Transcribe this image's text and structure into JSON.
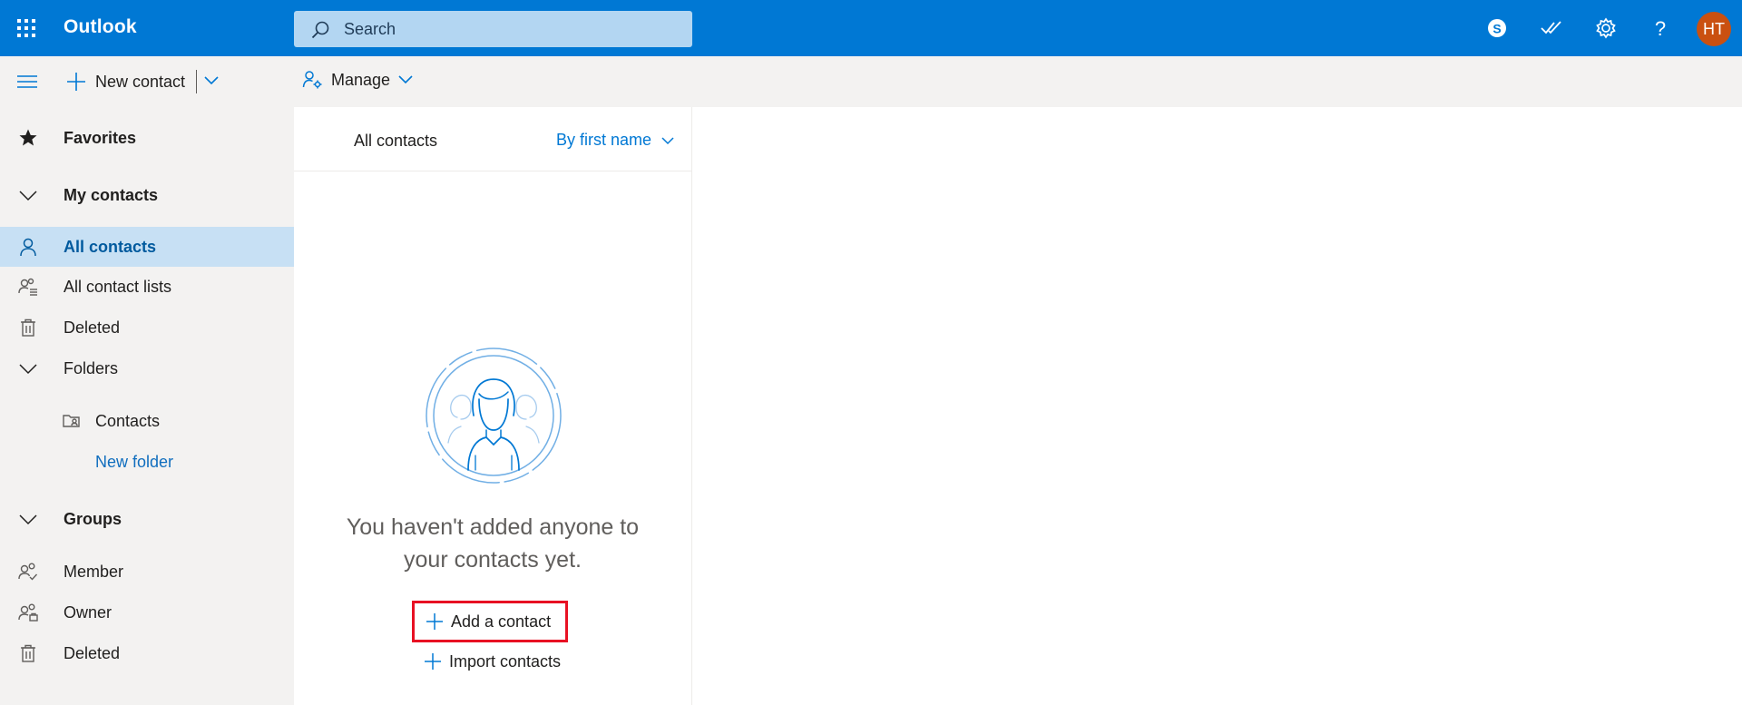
{
  "app": {
    "brand": "Outlook"
  },
  "search": {
    "placeholder": "Search"
  },
  "header": {
    "avatar_initials": "HT"
  },
  "toolbar": {
    "new_contact_label": "New contact",
    "manage_label": "Manage"
  },
  "sidebar": {
    "favorites": "Favorites",
    "my_contacts": "My contacts",
    "all_contacts": "All contacts",
    "all_contact_lists": "All contact lists",
    "deleted": "Deleted",
    "folders": "Folders",
    "contacts_folder": "Contacts",
    "new_folder": "New folder",
    "groups": "Groups",
    "member": "Member",
    "owner": "Owner",
    "groups_deleted": "Deleted"
  },
  "list": {
    "title": "All contacts",
    "sort_label": "By first name",
    "empty_line1": "You haven't added anyone to",
    "empty_line2": "your contacts yet.",
    "add_contact_label": "Add a contact",
    "import_contacts_label": "Import contacts"
  },
  "colors": {
    "brand_blue": "#0078d4",
    "avatar": "#ca5010",
    "selected_bg": "#c7e0f4",
    "highlight_red": "#e81123"
  }
}
